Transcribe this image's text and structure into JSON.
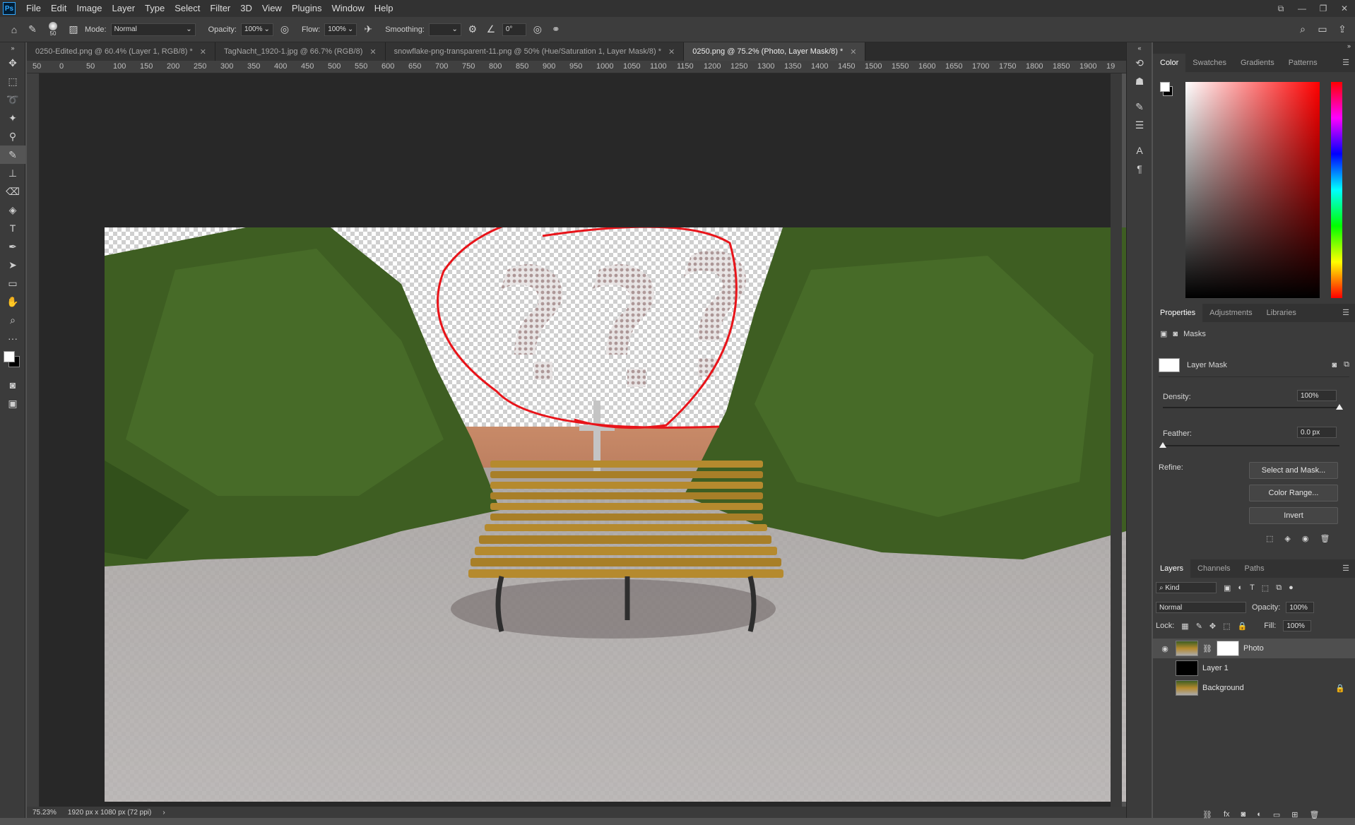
{
  "app": {
    "logo": "Ps"
  },
  "menu": [
    "File",
    "Edit",
    "Image",
    "Layer",
    "Type",
    "Select",
    "Filter",
    "3D",
    "View",
    "Plugins",
    "Window",
    "Help"
  ],
  "options": {
    "brush_size": "50",
    "mode_label": "Mode:",
    "mode_value": "Normal",
    "opacity_label": "Opacity:",
    "opacity_value": "100%",
    "flow_label": "Flow:",
    "flow_value": "100%",
    "smoothing_label": "Smoothing:",
    "smoothing_value": "",
    "angle_value": "0°"
  },
  "tabs": [
    {
      "label": "0250-Edited.png @ 60.4% (Layer 1, RGB/8) *"
    },
    {
      "label": "TagNacht_1920-1.jpg @ 66.7% (RGB/8)"
    },
    {
      "label": "snowflake-png-transparent-11.png @ 50% (Hue/Saturation 1, Layer Mask/8) *"
    },
    {
      "label": "0250.png @ 75.2% (Photo, Layer Mask/8) *"
    }
  ],
  "ruler_labels": [
    "50",
    "0",
    "50",
    "100",
    "150",
    "200",
    "250",
    "300",
    "350",
    "400",
    "450",
    "500",
    "550",
    "600",
    "650",
    "700",
    "750",
    "800",
    "850",
    "900",
    "950",
    "1000",
    "1050",
    "1100",
    "1150",
    "1200",
    "1250",
    "1300",
    "1350",
    "1400",
    "1450",
    "1500",
    "1550",
    "1600",
    "1650",
    "1700",
    "1750",
    "1800",
    "1850",
    "1900",
    "19"
  ],
  "status": {
    "zoom": "75.23%",
    "doc_info": "1920 px x 1080 px (72 ppi)"
  },
  "color_panel": {
    "tabs": [
      "Color",
      "Swatches",
      "Gradients",
      "Patterns"
    ]
  },
  "properties_panel": {
    "tabs": [
      "Properties",
      "Adjustments",
      "Libraries"
    ],
    "masks_label": "Masks",
    "layer_mask_label": "Layer Mask",
    "density_label": "Density:",
    "density_value": "100%",
    "density_level": 1.0,
    "feather_label": "Feather:",
    "feather_value": "0.0 px",
    "feather_level": 0.0,
    "refine_label": "Refine:",
    "buttons": [
      "Select and Mask...",
      "Color Range...",
      "Invert"
    ]
  },
  "layers_panel": {
    "tabs": [
      "Layers",
      "Channels",
      "Paths"
    ],
    "filter_kind": "Kind",
    "blend_mode": "Normal",
    "opacity_label": "Opacity:",
    "opacity_value": "100%",
    "lock_label": "Lock:",
    "fill_label": "Fill:",
    "fill_value": "100%",
    "layers": [
      {
        "name": "Photo",
        "visible": true,
        "active": true
      },
      {
        "name": "Layer 1",
        "visible": false,
        "active": false
      },
      {
        "name": "Background",
        "visible": false,
        "active": false
      }
    ]
  },
  "colors": {
    "accent_annotation": "#e8141a",
    "bench": "#b58a2e",
    "tree": "#3e5e22"
  }
}
